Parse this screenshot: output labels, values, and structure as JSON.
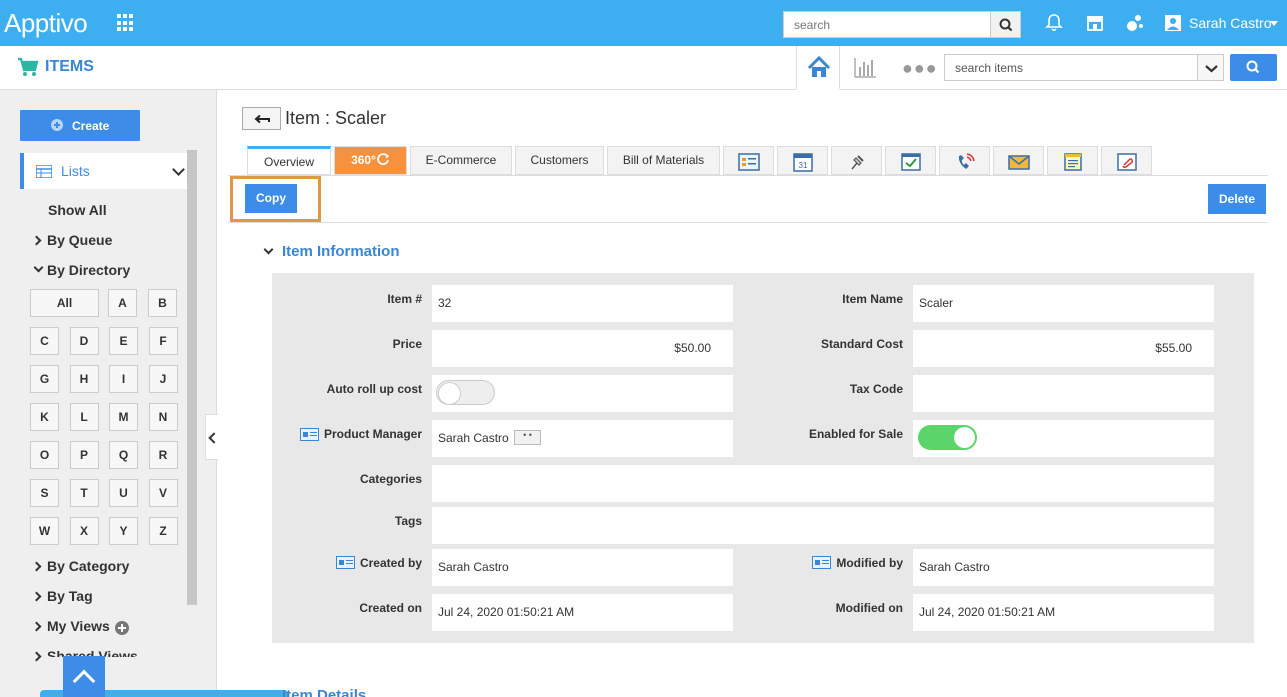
{
  "app": {
    "logo": "Apptivo",
    "search_placeholder": "search",
    "user_name": "Sarah Castro"
  },
  "module": {
    "title": "ITEMS",
    "search_placeholder": "search items"
  },
  "sidebar": {
    "create_label": "Create",
    "lists_label": "Lists",
    "show_all": "Show All",
    "by_queue": "By Queue",
    "by_directory": "By Directory",
    "letters": [
      "All",
      "A",
      "B",
      "C",
      "D",
      "E",
      "F",
      "G",
      "H",
      "I",
      "J",
      "K",
      "L",
      "M",
      "N",
      "O",
      "P",
      "Q",
      "R",
      "S",
      "T",
      "U",
      "V",
      "W",
      "X",
      "Y",
      "Z"
    ],
    "by_category": "By Category",
    "by_tag": "By Tag",
    "my_views": "My Views",
    "shared_views": "Shared Views"
  },
  "page": {
    "title": "Item : Scaler",
    "tabs": [
      "Overview",
      "360°",
      "E-Commerce",
      "Customers",
      "Bill of Materials"
    ],
    "copy_label": "Copy",
    "delete_label": "Delete",
    "section_title": "Item Information",
    "next_section_title": "Item Details"
  },
  "form": {
    "item_no_label": "Item #",
    "item_no": "32",
    "item_name_label": "Item Name",
    "item_name": "Scaler",
    "price_label": "Price",
    "price": "$50.00",
    "standard_cost_label": "Standard Cost",
    "standard_cost": "$55.00",
    "auto_rollup_label": "Auto roll up cost",
    "auto_rollup_on": false,
    "tax_code_label": "Tax Code",
    "tax_code": "",
    "product_manager_label": "Product Manager",
    "product_manager": "Sarah Castro",
    "enabled_for_sale_label": "Enabled for Sale",
    "enabled_for_sale_on": true,
    "categories_label": "Categories",
    "categories": "",
    "tags_label": "Tags",
    "tags": "",
    "created_by_label": "Created by",
    "created_by": "Sarah Castro",
    "modified_by_label": "Modified by",
    "modified_by": "Sarah Castro",
    "created_on_label": "Created on",
    "created_on": "Jul 24, 2020 01:50:21 AM",
    "modified_on_label": "Modified on",
    "modified_on": "Jul 24, 2020 01:50:21 AM"
  },
  "colors": {
    "topbar": "#3daef0",
    "primary": "#3d8de8",
    "orange_tab": "#f7913d",
    "highlight": "#e29843",
    "toggle_on": "#5bd46a"
  }
}
